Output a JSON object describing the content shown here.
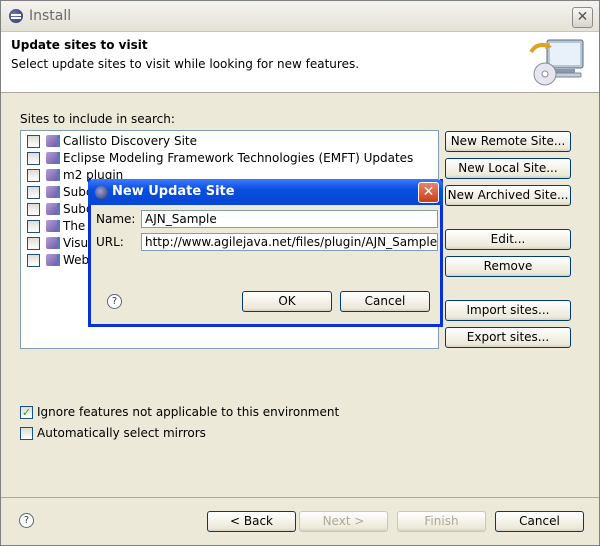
{
  "window": {
    "title": "Install",
    "close_glyph": "✕"
  },
  "header": {
    "title": "Update sites to visit",
    "description": "Select update sites to visit while looking for new features."
  },
  "sites": {
    "label": "Sites to include in search:",
    "items": [
      {
        "label": "Callisto Discovery Site"
      },
      {
        "label": "Eclipse Modeling Framework Technologies (EMFT) Updates"
      },
      {
        "label": "m2 plugin"
      },
      {
        "label": "Subc"
      },
      {
        "label": "Subc"
      },
      {
        "label": "The"
      },
      {
        "label": "Visu"
      },
      {
        "label": "Web"
      }
    ]
  },
  "buttons": {
    "new_remote": "New Remote Site...",
    "new_local": "New Local Site...",
    "new_archived": "New Archived Site...",
    "edit": "Edit...",
    "remove": "Remove",
    "import": "Import sites...",
    "export": "Export sites..."
  },
  "options": {
    "ignore_features": {
      "label": "Ignore features not applicable to this environment",
      "checked": true
    },
    "auto_mirrors": {
      "label": "Automatically select mirrors",
      "checked": false
    }
  },
  "footer": {
    "help": "?",
    "back": "< Back",
    "next": "Next >",
    "finish": "Finish",
    "cancel": "Cancel"
  },
  "dialog": {
    "title": "New Update Site",
    "close_glyph": "✕",
    "name_label": "Name:",
    "name_value": "AJN_Sample",
    "url_label": "URL:",
    "url_value": "http://www.agilejava.net/files/plugin/AJN_Sample",
    "help": "?",
    "ok": "OK",
    "cancel": "Cancel"
  },
  "colors": {
    "dialog_title": "#0a4fe0",
    "accent_border": "#003c74"
  }
}
